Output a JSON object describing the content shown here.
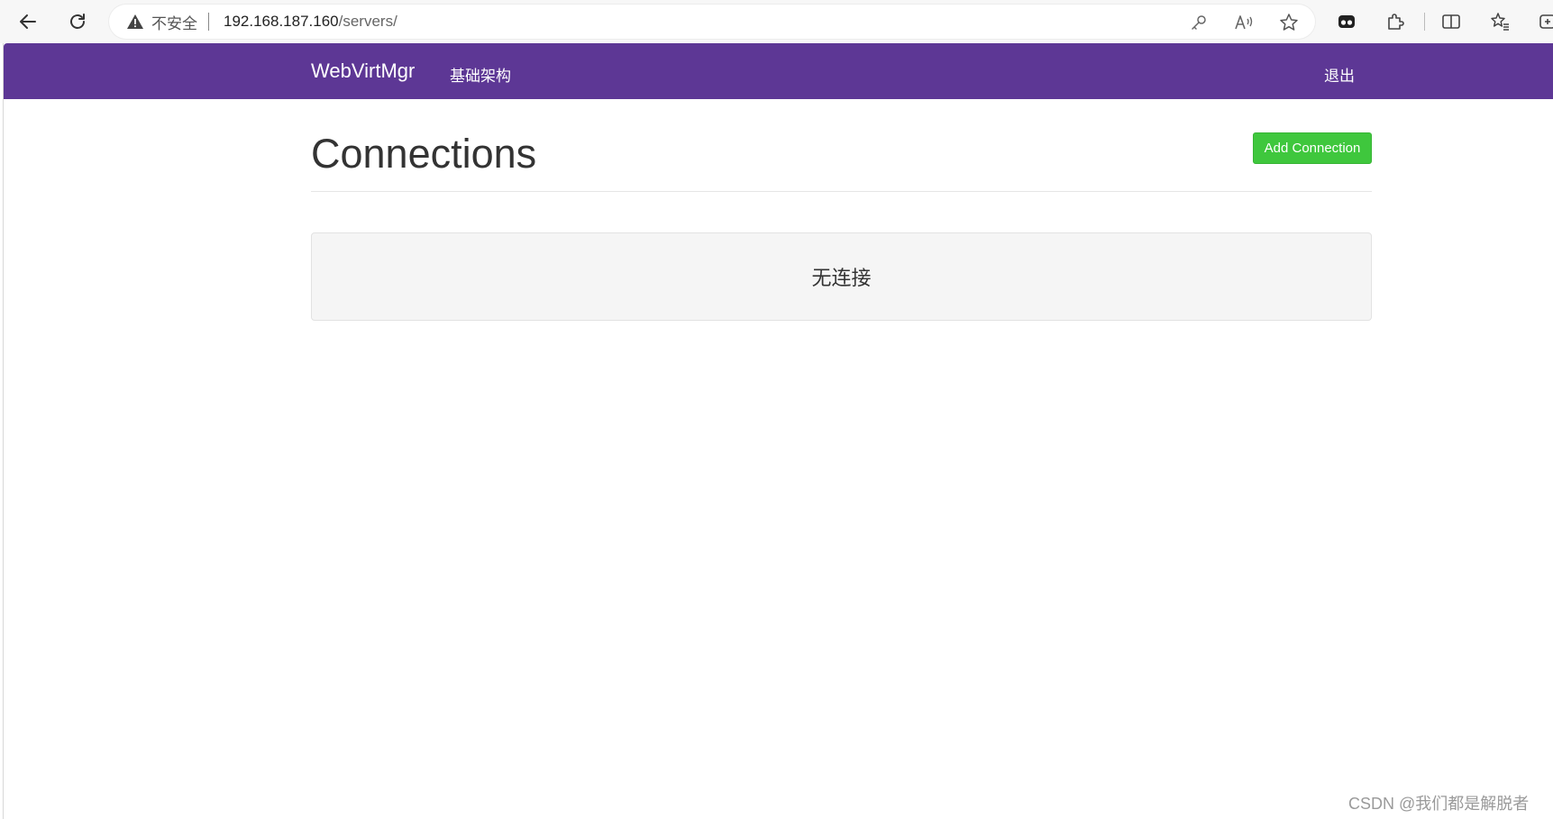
{
  "browser": {
    "insecure_label": "不安全",
    "url_host": "192.168.187.160",
    "url_path": "/servers/"
  },
  "icons": {
    "back": "arrow-left-icon",
    "reload": "reload-icon",
    "warning": "warning-triangle-icon",
    "key": "key-icon",
    "read_aloud": "read-aloud-icon",
    "favorite": "star-icon",
    "extension_1": "extension-icon",
    "extension_2": "puzzle-icon",
    "split": "split-screen-icon",
    "favorites": "favorites-icon",
    "collections": "collections-icon"
  },
  "navbar": {
    "brand": "WebVirtMgr",
    "infrastructure": "基础架构",
    "logout": "退出",
    "color": "#5d3795"
  },
  "main": {
    "title": "Connections",
    "add_button": "Add Connection",
    "add_button_color": "#3fc73d",
    "empty_message": "无连接"
  },
  "watermark": "CSDN @我们都是解脱者"
}
